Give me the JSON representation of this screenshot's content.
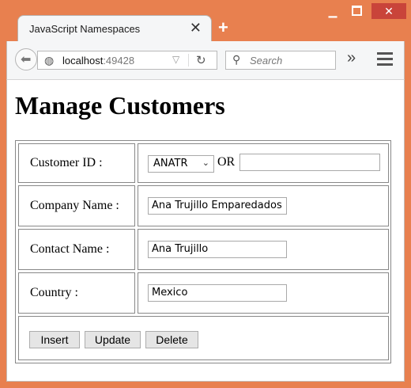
{
  "browser": {
    "tab_title": "JavaScript Namespaces",
    "tab_close": "✕",
    "new_tab": "+",
    "url_host": "localhost",
    "url_port": ":49428",
    "search_placeholder": "Search",
    "overflow": "»",
    "window_min": "▁",
    "window_close": "✕"
  },
  "page": {
    "title": "Manage Customers"
  },
  "form": {
    "customer_id_label": "Customer ID :",
    "customer_id_selected": "ANATR",
    "or_label": "OR",
    "customer_id_text": "",
    "company_label": "Company Name :",
    "company_value": "Ana Trujillo Emparedados",
    "contact_label": "Contact Name :",
    "contact_value": "Ana Trujillo",
    "country_label": "Country :",
    "country_value": "Mexico"
  },
  "buttons": {
    "insert": "Insert",
    "update": "Update",
    "delete": "Delete"
  },
  "colors": {
    "window_frame": "#e8804f",
    "close_button": "#c9443a"
  }
}
